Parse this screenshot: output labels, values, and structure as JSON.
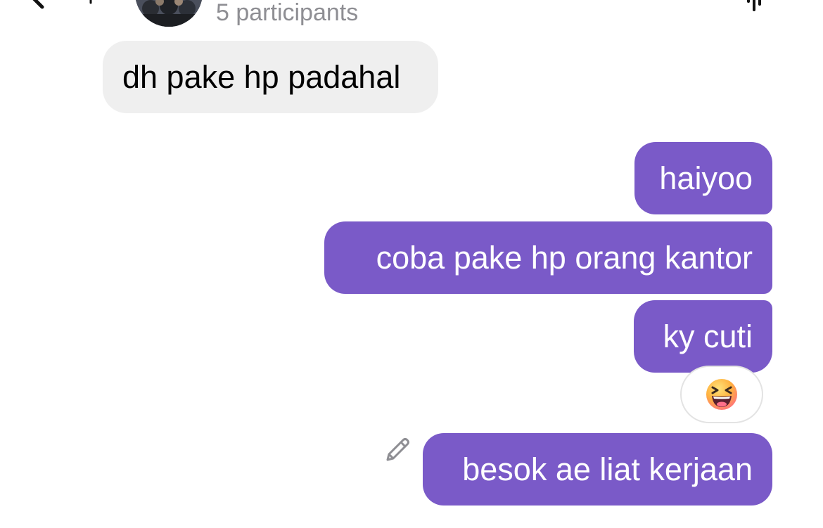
{
  "header": {
    "participants_text": "5 participants",
    "icons": [
      "back-chevron-icon",
      "waveform-icon"
    ]
  },
  "messages": [
    {
      "direction": "incoming",
      "text": "dh pake hp padahal"
    },
    {
      "direction": "outgoing",
      "text": "haiyoo"
    },
    {
      "direction": "outgoing",
      "text": "coba pake hp orang kantor"
    },
    {
      "direction": "outgoing",
      "text": "ky cuti",
      "reaction": "grinning-squinting-face-emoji"
    },
    {
      "direction": "outgoing",
      "text": "besok ae liat kerjaan",
      "edited_icon": "pencil-icon"
    }
  ],
  "colors": {
    "outgoing_bubble": "#7a5ac8",
    "incoming_bubble": "#efefef",
    "secondary_text": "#8e8e93"
  }
}
